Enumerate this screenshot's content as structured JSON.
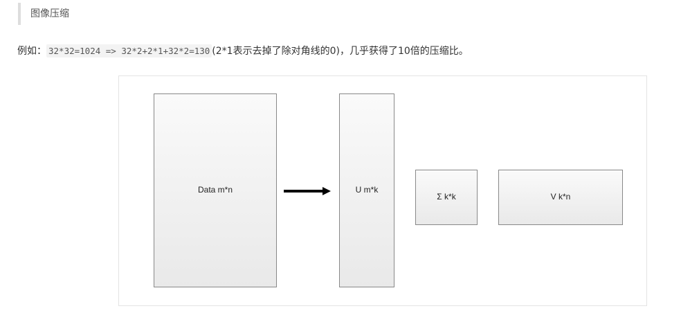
{
  "section": {
    "quote_title": "图像压缩"
  },
  "paragraph": {
    "prefix": "例如：",
    "code": "32*32=1024 => 32*2+2*1+32*2=130",
    "suffix": "(2*1表示去掉了除对角线的0)，几乎获得了10倍的压缩比。"
  },
  "diagram": {
    "data_label": "Data m*n",
    "u_label": "U m*k",
    "sigma_label": "Σ k*k",
    "v_label": "V k*n"
  }
}
